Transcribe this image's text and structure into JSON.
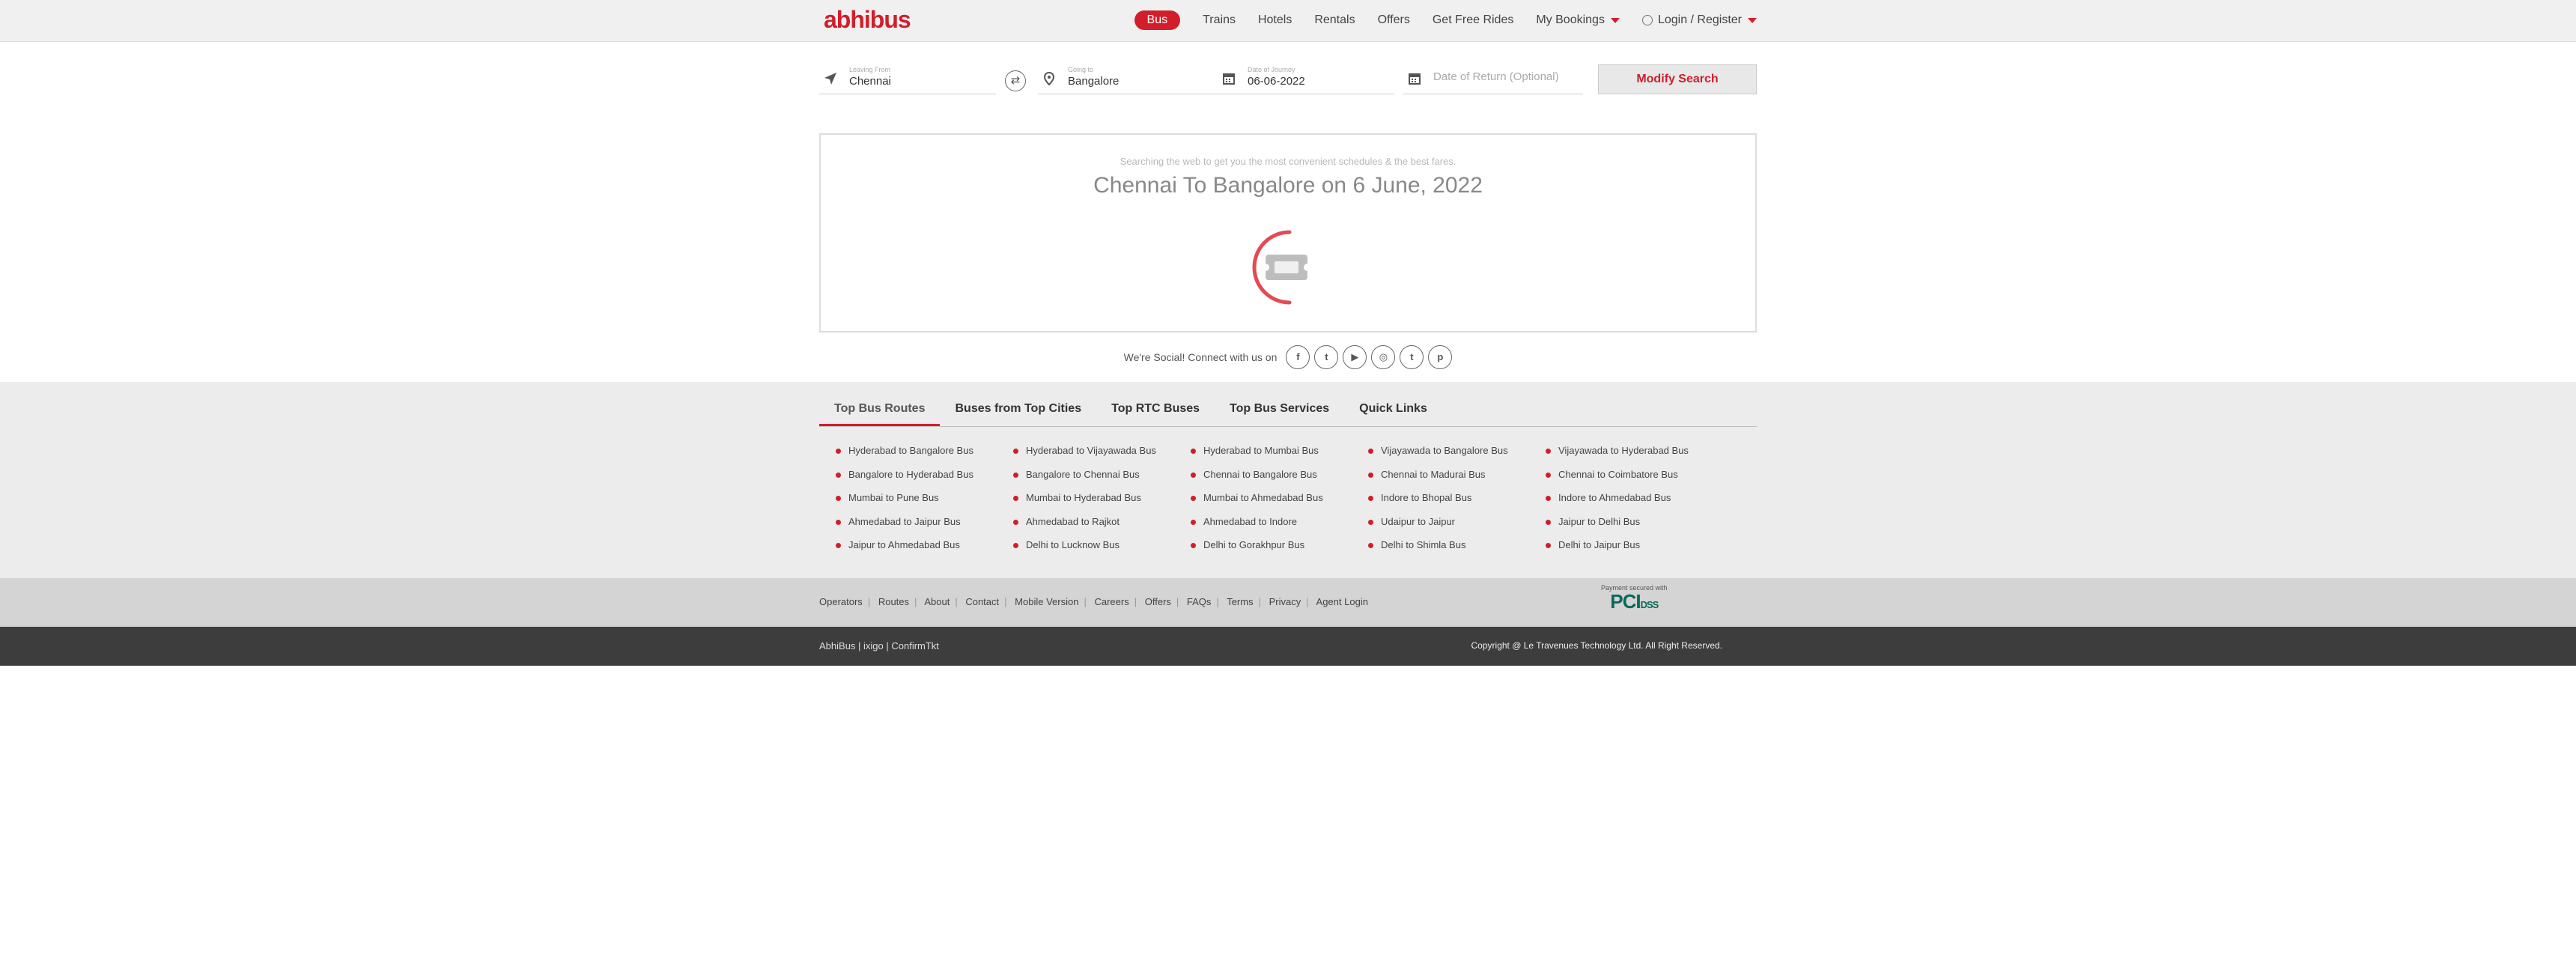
{
  "brand": {
    "logo": "abhibus"
  },
  "nav": {
    "items": [
      "Bus",
      "Trains",
      "Hotels",
      "Rentals",
      "Offers",
      "Get Free Rides"
    ],
    "bookings": "My Bookings",
    "login": "Login / Register"
  },
  "search": {
    "from_label": "Leaving From",
    "from_value": "Chennai",
    "to_label": "Going to",
    "to_value": "Bangalore",
    "date_label": "Date of Journey",
    "date_value": "06-06-2022",
    "return_placeholder": "Date of Return (Optional)",
    "modify_label": "Modify Search"
  },
  "loading": {
    "subtitle": "Searching the web to get you the most convenient schedules & the best fares.",
    "route": "Chennai To Bangalore on 6 June, 2022"
  },
  "social": {
    "label": "We're Social! Connect with us on",
    "icons": [
      "facebook-icon",
      "twitter-icon",
      "youtube-icon",
      "instagram-icon",
      "tumblr-icon",
      "pinterest-icon"
    ]
  },
  "tabs": [
    "Top Bus Routes",
    "Buses from Top Cities",
    "Top RTC Buses",
    "Top Bus Services",
    "Quick Links"
  ],
  "routes": [
    [
      "Hyderabad to Bangalore Bus",
      "Bangalore to Hyderabad Bus",
      "Mumbai to Pune Bus",
      "Ahmedabad to Jaipur Bus",
      "Jaipur to Ahmedabad Bus"
    ],
    [
      "Hyderabad to Vijayawada Bus",
      "Bangalore to Chennai Bus",
      "Mumbai to Hyderabad Bus",
      "Ahmedabad to Rajkot",
      "Delhi to Lucknow Bus"
    ],
    [
      "Hyderabad to Mumbai Bus",
      "Chennai to Bangalore Bus",
      "Mumbai to Ahmedabad Bus",
      "Ahmedabad to Indore",
      "Delhi to Gorakhpur Bus"
    ],
    [
      "Vijayawada to Bangalore Bus",
      "Chennai to Madurai Bus",
      "Indore to Bhopal Bus",
      "Udaipur to Jaipur",
      "Delhi to Shimla Bus"
    ],
    [
      "Vijayawada to Hyderabad Bus",
      "Chennai to Coimbatore Bus",
      "Indore to Ahmedabad Bus",
      "Jaipur to Delhi Bus",
      "Delhi to Jaipur Bus"
    ]
  ],
  "footer": {
    "links": [
      "Operators",
      "Routes",
      "About",
      "Contact",
      "Mobile Version",
      "Careers",
      "Offers",
      "FAQs",
      "Terms",
      "Privacy",
      "Agent Login"
    ],
    "pci_caption": "Payment secured with",
    "pci_logo": "PCI",
    "pci_dss": "DSS",
    "brands": "AbhiBus | ixigo | ConfirmTkt",
    "copyright": "Copyright @ Le Travenues Technology Ltd. All Right Reserved."
  },
  "colors": {
    "accent": "#d21e2b",
    "header_bg": "#f0f0f0",
    "footer_dark": "#3d3d3d"
  }
}
